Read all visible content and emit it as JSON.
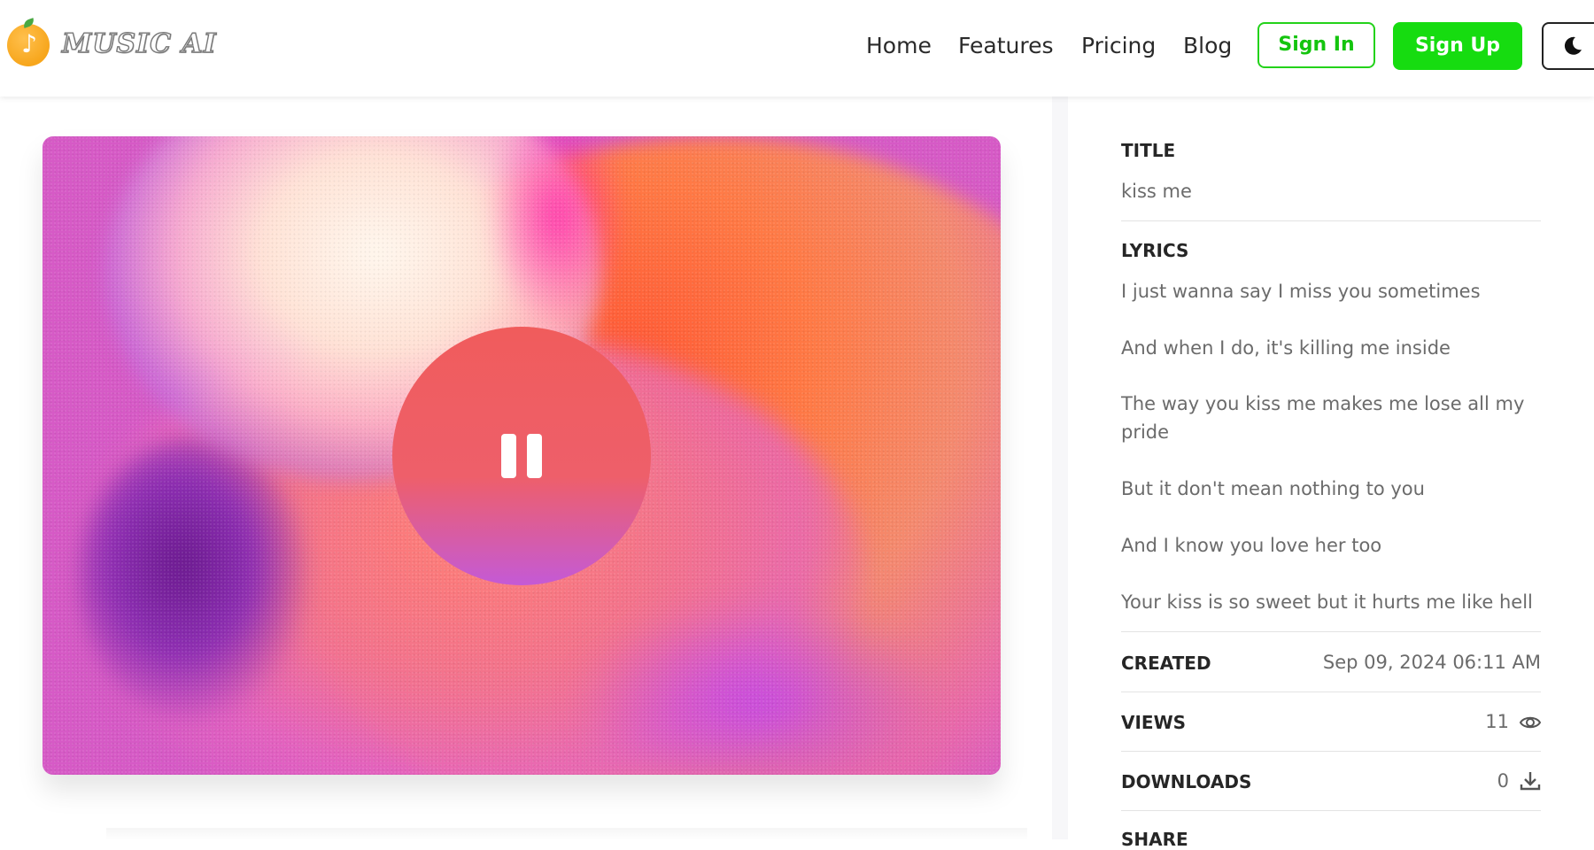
{
  "header": {
    "logo_text": "MUSIC AI",
    "logo_icon": "orange-music-note-icon",
    "nav": [
      {
        "label": "Home"
      },
      {
        "label": "Features"
      },
      {
        "label": "Pricing"
      },
      {
        "label": "Blog"
      }
    ],
    "sign_in_label": "Sign In",
    "sign_up_label": "Sign Up",
    "theme_icon": "moon-icon"
  },
  "player": {
    "state_icon": "pause-icon"
  },
  "details": {
    "title_label": "TITLE",
    "title_value": "kiss me",
    "lyrics_label": "LYRICS",
    "lyrics": [
      "I just wanna say I miss you sometimes",
      "And when I do, it's killing me inside",
      "The way you kiss me makes me lose all my pride",
      "But it don't mean nothing to you",
      "And I know you love her too",
      "Your kiss is so sweet but it hurts me like hell"
    ],
    "created_label": "CREATED",
    "created_value": "Sep 09, 2024 06:11 AM",
    "views_label": "VIEWS",
    "views_value": "11",
    "downloads_label": "DOWNLOADS",
    "downloads_value": "0",
    "share_label": "SHARE"
  },
  "colors": {
    "accent_green": "#16dc10",
    "artwork_base": "#d65ac6"
  }
}
